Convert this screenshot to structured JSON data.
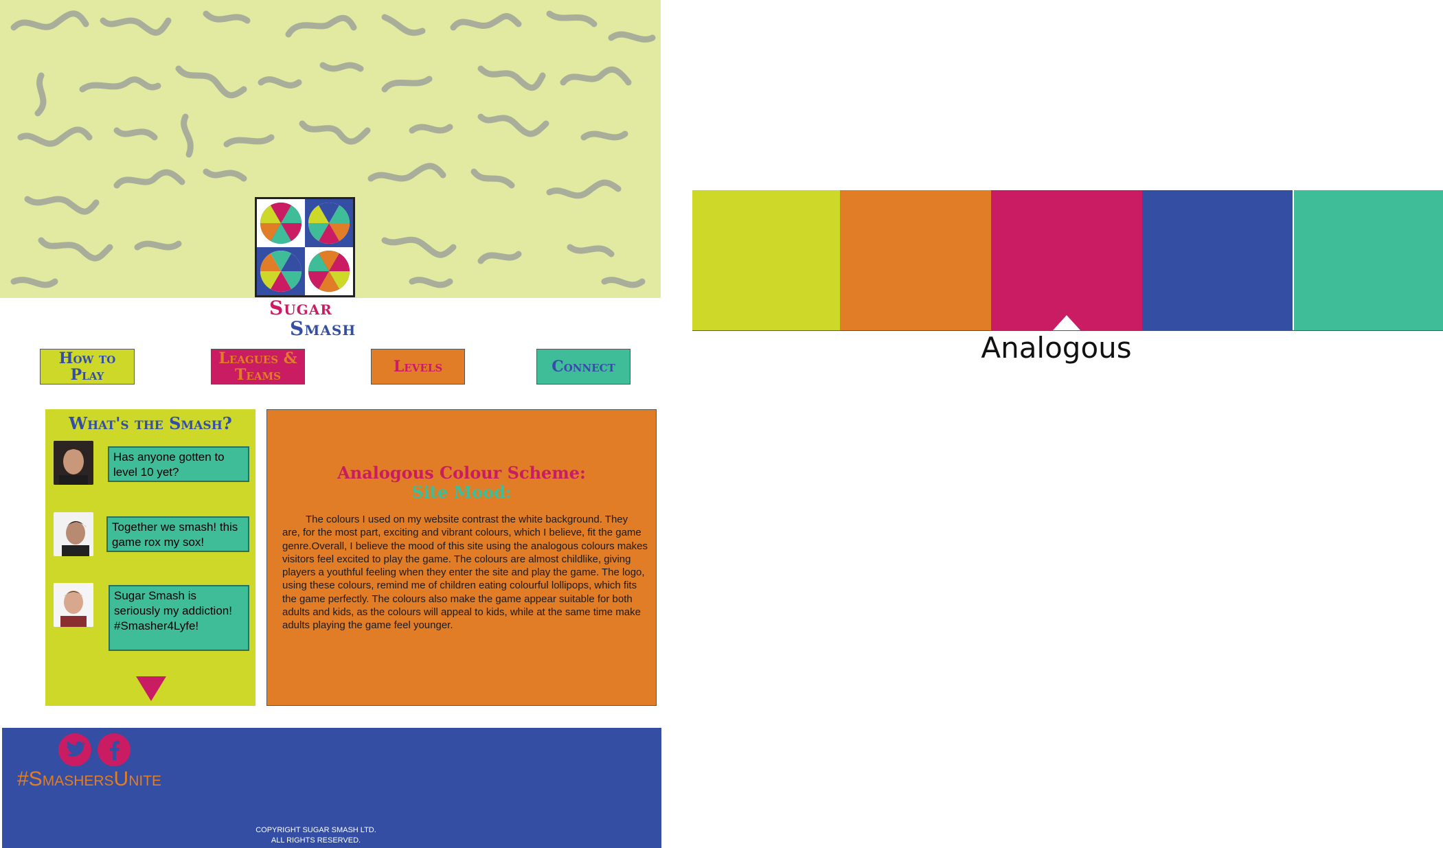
{
  "brand": {
    "word1": "Sugar",
    "word2": "Smash"
  },
  "nav": [
    {
      "label": "How to Play",
      "bg": "#cdd828",
      "fg": "#334ea3"
    },
    {
      "label": "Leagues & Teams",
      "bg": "#c91c63",
      "fg": "#e07d26"
    },
    {
      "label": "Levels",
      "bg": "#e07d26",
      "fg": "#c91c63"
    },
    {
      "label": "Connect",
      "bg": "#3fbd99",
      "fg": "#334ea3"
    }
  ],
  "chat": {
    "title": "What's the Smash?",
    "messages": [
      {
        "text": "Has anyone gotten to level 10 yet?"
      },
      {
        "text": "Together we smash! this game rox my sox!"
      },
      {
        "text": "Sugar Smash is seriously my addiction! #Smasher4Lyfe!"
      }
    ]
  },
  "description": {
    "title": "Analogous Colour Scheme:",
    "subtitle": "Site Mood:",
    "body": "The colours I used on my website contrast the white background. They are, for the most part, exciting and vibrant colours, which I believe, fit the game genre.Overall, I believe the mood of this site using the analogous colours makes visitors feel excited to play the game. The colours are almost childlike, giving players a youthful feeling when they enter the site and play the game. The logo, using these colours, remind me of children eating colourful lollipops, which fits the game perfectly. The colours also make the game appear suitable for both adults and kids, as the colours will appeal to kids, while at the same time make adults playing the game feel younger."
  },
  "footer": {
    "social": [
      {
        "icon": "twitter-icon"
      },
      {
        "icon": "facebook-icon"
      }
    ],
    "hashtag": "#SmashersUnite",
    "copyright_line1": "COPYRIGHT SUGAR SMASH LTD.",
    "copyright_line2": "ALL RIGHTS RESERVED."
  },
  "palette": {
    "label": "Analogous",
    "swatches": [
      "#cdd828",
      "#e07d26",
      "#c91c63",
      "#334ea3",
      "#3fbd99"
    ]
  },
  "colors": {
    "hero_bg": "#e2e9a0",
    "squiggle": "#a9ae9b",
    "lime": "#cdd828",
    "orange": "#e07d26",
    "magenta": "#c91c63",
    "blue": "#334ea3",
    "teal": "#3fbd99"
  }
}
